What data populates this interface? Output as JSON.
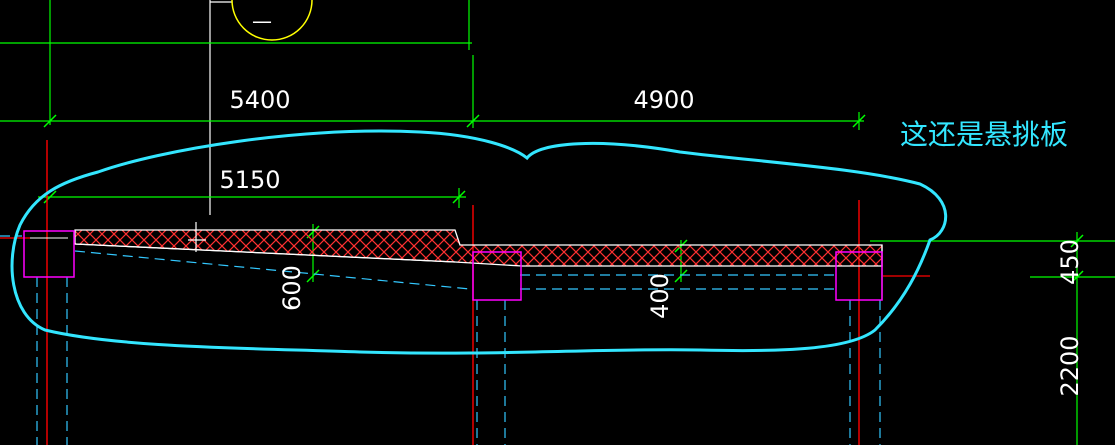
{
  "drawing": {
    "background_color": "#000000",
    "colors": {
      "dimension_line": "#00ff00",
      "dimension_text": "#ffffff",
      "hatch": "#ff3030",
      "column": "#ff00ff",
      "hidden_line": "#33c8ff",
      "axis_line": "#ff0000",
      "annotation": "#33e6ff",
      "section_symbol": "#ffff00"
    },
    "section_symbol_label": "—",
    "dimensions": {
      "span_left": "5400",
      "span_right": "4900",
      "cantilever_length": "5150",
      "beam_depth_left": "600",
      "beam_depth_right": "400",
      "right_top": "450",
      "right_bottom": "2200"
    },
    "annotation": {
      "text": "这还是悬挑板"
    }
  }
}
